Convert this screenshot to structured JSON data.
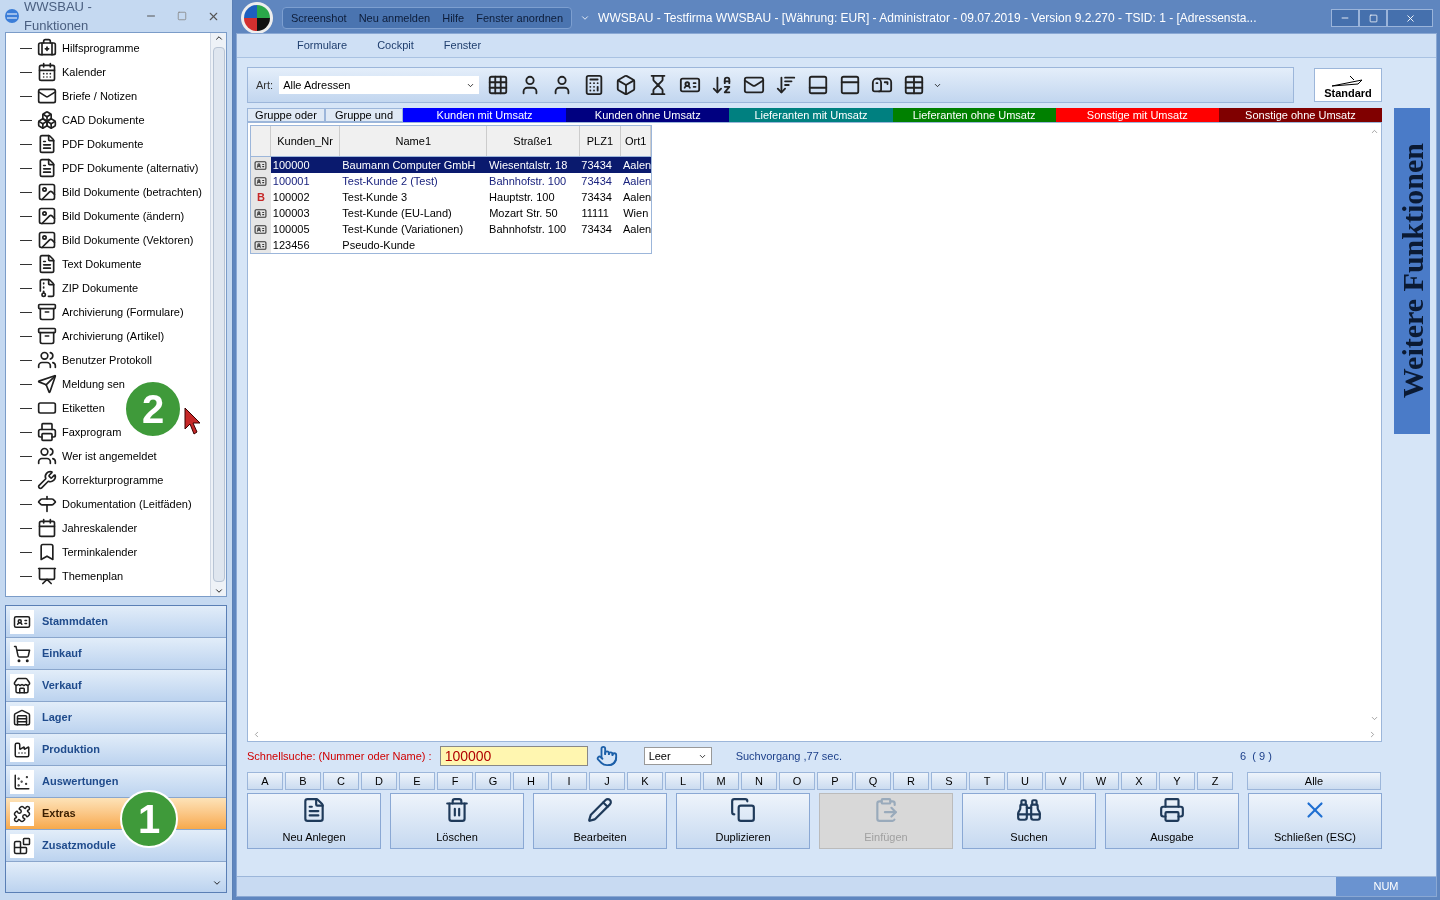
{
  "left_panel": {
    "title": "WWSBAU - Funktionen",
    "tree_items": [
      "Hilfsprogramme",
      "Kalender",
      "Briefe / Notizen",
      "CAD Dokumente",
      "PDF Dokumente",
      "PDF Dokumente (alternativ)",
      "Bild Dokumente (betrachten)",
      "Bild Dokumente (ändern)",
      "Bild Dokumente (Vektoren)",
      "Text Dokumente",
      "ZIP Dokumente",
      "Archivierung (Formulare)",
      "Archivierung (Artikel)",
      "Benutzer Protokoll",
      "Meldung sen",
      "Etiketten",
      "Faxprogram",
      "Wer ist angemeldet",
      "Korrekturprogramme",
      "Dokumentation (Leitfäden)",
      "Jahreskalender",
      "Terminkalender",
      "Themenplan"
    ],
    "nav_items": [
      {
        "label": "Stammdaten",
        "selected": false
      },
      {
        "label": "Einkauf",
        "selected": false
      },
      {
        "label": "Verkauf",
        "selected": false
      },
      {
        "label": "Lager",
        "selected": false
      },
      {
        "label": "Produktion",
        "selected": false
      },
      {
        "label": "Auswertungen",
        "selected": false
      },
      {
        "label": "Extras",
        "selected": true
      },
      {
        "label": "Zusatzmodule",
        "selected": false
      }
    ]
  },
  "callouts": [
    {
      "label": "2"
    },
    {
      "label": "1"
    }
  ],
  "main": {
    "quick_access": [
      "Screenshot",
      "Neu anmelden",
      "Hilfe",
      "Fenster anordnen"
    ],
    "title": "WWSBAU - Testfirma WWSBAU - [Währung: EUR] - Administrator - 09.07.2019 - Version 9.2.270 - TSID: 1  - [Adressensta...",
    "menu": [
      "Formulare",
      "Cockpit",
      "Fenster"
    ],
    "art_label": "Art:",
    "art_value": "Alle Adressen",
    "standard_label": "Standard",
    "side_tab": "Weitere Funktionen",
    "group_tabs": [
      "Gruppe oder",
      "Gruppe und"
    ],
    "filters": [
      {
        "label": "Kunden mit Umsatz",
        "color": "#0000ff"
      },
      {
        "label": "Kunden ohne Umsatz",
        "color": "#000080"
      },
      {
        "label": "Lieferanten mit Umsatz",
        "color": "#008080"
      },
      {
        "label": "Lieferanten ohne Umsatz",
        "color": "#008000"
      },
      {
        "label": "Sonstige mit Umsatz",
        "color": "#ff0000"
      },
      {
        "label": "Sonstige ohne Umsatz",
        "color": "#800000"
      }
    ],
    "table": {
      "columns": [
        "Kunden_Nr",
        "Name1",
        "Straße1",
        "PLZ1",
        "Ort1"
      ],
      "rows": [
        {
          "kind": "card",
          "selected": true,
          "cells": [
            "100000",
            "Baumann Computer GmbH",
            "Wiesentalstr. 18",
            "73434",
            "Aalen"
          ]
        },
        {
          "kind": "card",
          "selected": false,
          "emphasis": true,
          "cells": [
            "100001",
            "Test-Kunde 2  (Test)",
            "Bahnhofstr. 100",
            "73434",
            "Aalen"
          ]
        },
        {
          "kind": "letter",
          "marker": "B",
          "selected": false,
          "emphasis": false,
          "cells": [
            "100002",
            "Test-Kunde 3",
            "Hauptstr. 100",
            "73434",
            "Aalen"
          ]
        },
        {
          "kind": "card",
          "selected": false,
          "emphasis": false,
          "cells": [
            "100003",
            "Test-Kunde (EU-Land)",
            "Mozart Str. 50",
            "11111",
            "Wien"
          ]
        },
        {
          "kind": "card",
          "selected": false,
          "emphasis": false,
          "cells": [
            "100005",
            "Test-Kunde (Variationen)",
            "Bahnhofstr. 100",
            "73434",
            "Aalen"
          ]
        },
        {
          "kind": "card",
          "selected": false,
          "emphasis": false,
          "cells": [
            "123456",
            "Pseudo-Kunde",
            "",
            "",
            ""
          ]
        }
      ]
    },
    "search_label": "Schnellsuche: (Nummer oder Name) :",
    "search_value": "100000",
    "mode_value": "Leer",
    "search_time": "Suchvorgang ,77 sec.",
    "count": "6  ( 9 )",
    "letters": [
      "A",
      "B",
      "C",
      "D",
      "E",
      "F",
      "G",
      "H",
      "I",
      "J",
      "K",
      "L",
      "M",
      "N",
      "O",
      "P",
      "Q",
      "R",
      "S",
      "T",
      "U",
      "V",
      "W",
      "X",
      "Y",
      "Z"
    ],
    "all_label": "Alle",
    "actions": [
      {
        "label": "Neu Anlegen",
        "disabled": false
      },
      {
        "label": "Löschen",
        "disabled": false
      },
      {
        "label": "Bearbeiten",
        "disabled": false
      },
      {
        "label": "Duplizieren",
        "disabled": false
      },
      {
        "label": "Einfügen",
        "disabled": true
      },
      {
        "label": "Suchen",
        "disabled": false
      },
      {
        "label": "Ausgabe",
        "disabled": false
      },
      {
        "label": "Schließen (ESC)",
        "disabled": false
      }
    ],
    "status": "NUM"
  }
}
